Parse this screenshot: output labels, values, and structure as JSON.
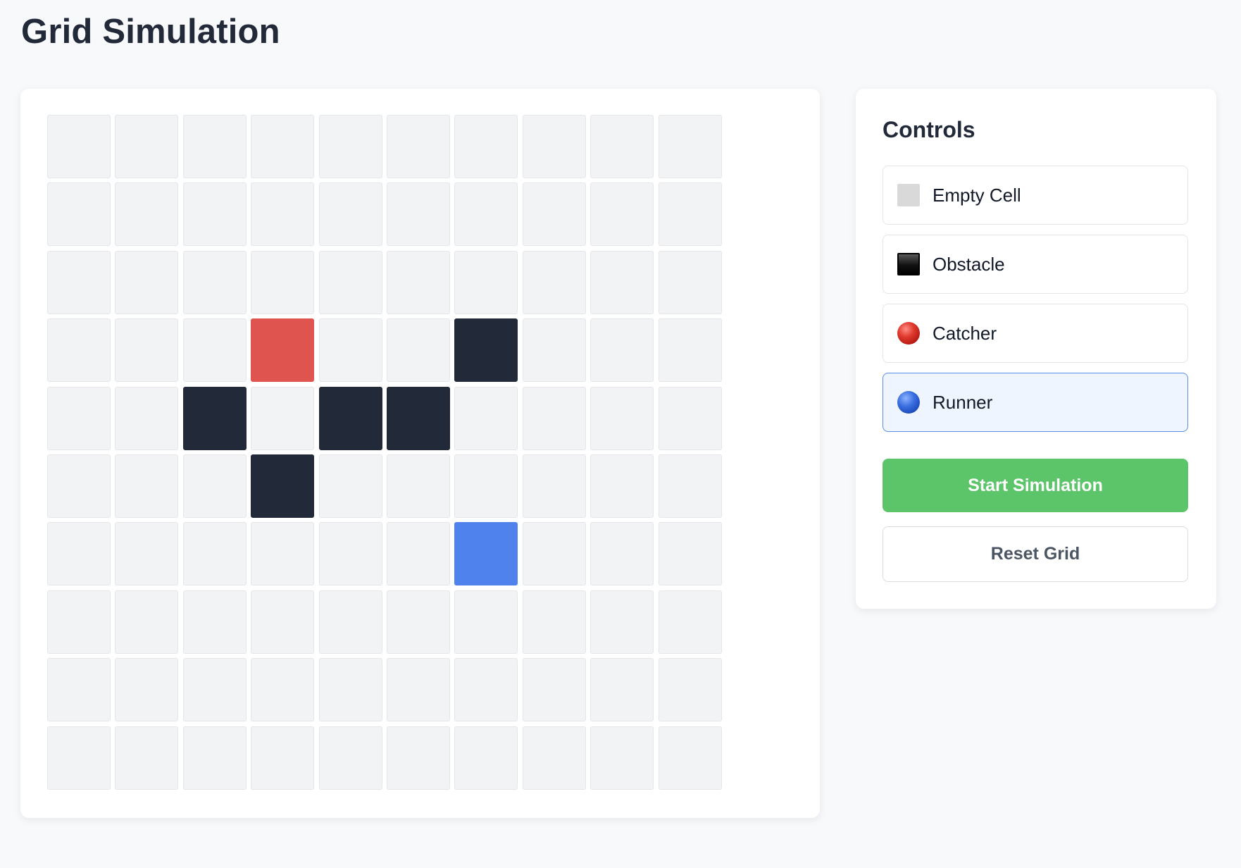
{
  "page": {
    "title": "Grid Simulation"
  },
  "grid": {
    "rows": 10,
    "cols": 10,
    "cells": {
      "catcher": [
        [
          3,
          3
        ]
      ],
      "runner": [
        [
          6,
          6
        ]
      ],
      "obstacles": [
        [
          3,
          6
        ],
        [
          4,
          2
        ],
        [
          4,
          4
        ],
        [
          4,
          5
        ],
        [
          5,
          3
        ]
      ]
    },
    "colors": {
      "empty": "#f2f3f5",
      "obstacle": "#222938",
      "catcher": "#e0544f",
      "runner": "#4f82ec"
    }
  },
  "controls": {
    "title": "Controls",
    "options": [
      {
        "label": "Empty Cell",
        "icon": "empty-cell-swatch-icon",
        "selected": false
      },
      {
        "label": "Obstacle",
        "icon": "black-square-icon",
        "selected": false
      },
      {
        "label": "Catcher",
        "icon": "red-circle-icon",
        "selected": false
      },
      {
        "label": "Runner",
        "icon": "blue-circle-icon",
        "selected": true
      }
    ],
    "start_button": "Start Simulation",
    "reset_button": "Reset Grid",
    "colors": {
      "start": "#5cc469",
      "selected_border": "#5b8ee6",
      "selected_bg": "#eef5fe"
    }
  }
}
